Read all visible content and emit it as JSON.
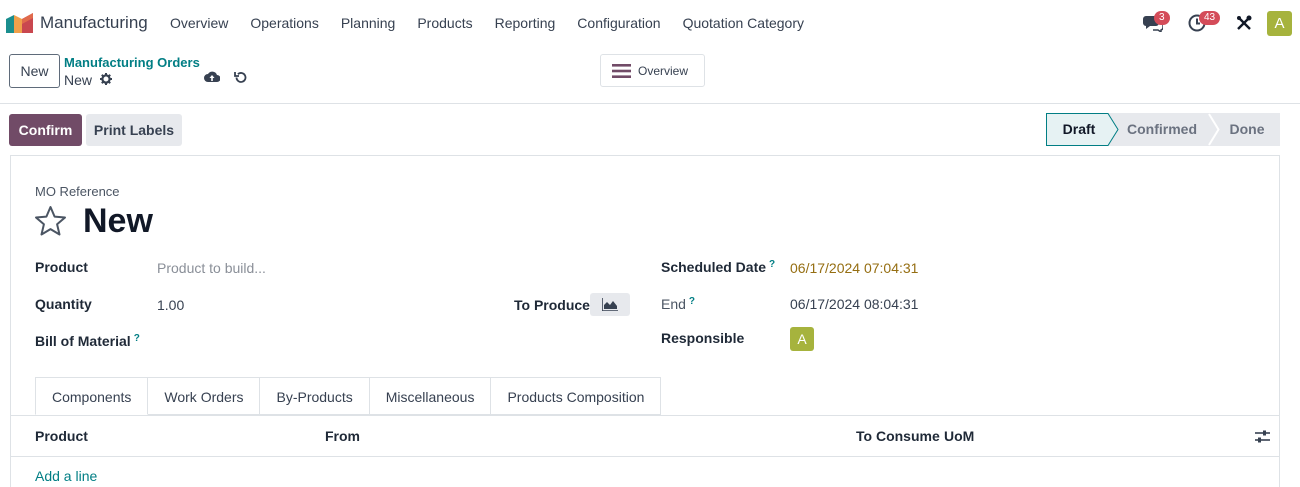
{
  "navbar": {
    "app_name": "Manufacturing",
    "menu": [
      "Overview",
      "Operations",
      "Planning",
      "Products",
      "Reporting",
      "Configuration",
      "Quotation Category"
    ],
    "messages_count": "3",
    "activities_count": "43",
    "user_initial": "A"
  },
  "control_panel": {
    "new_label": "New",
    "breadcrumb_parent": "Manufacturing Orders",
    "breadcrumb_current": "New",
    "overview_label": "Overview"
  },
  "statusbar": {
    "confirm_label": "Confirm",
    "print_labels_label": "Print Labels",
    "stages": [
      "Draft",
      "Confirmed",
      "Done"
    ],
    "active_stage": "Draft"
  },
  "form": {
    "ref_label": "MO Reference",
    "title": "New",
    "product_label": "Product",
    "product_placeholder": "Product to build...",
    "quantity_label": "Quantity",
    "quantity_value": "1.00",
    "to_produce_label": "To Produce",
    "bom_label": "Bill of Material",
    "scheduled_label": "Scheduled Date",
    "scheduled_value": "06/17/2024 07:04:31",
    "end_label": "End",
    "end_value": "06/17/2024 08:04:31",
    "responsible_label": "Responsible",
    "responsible_initial": "A",
    "help_mark": "?"
  },
  "tabs": [
    "Components",
    "Work Orders",
    "By-Products",
    "Miscellaneous",
    "Products Composition"
  ],
  "table": {
    "headers": [
      "Product",
      "From",
      "To Consume",
      "UoM"
    ],
    "add_line": "Add a line"
  },
  "colors": {
    "primary": "#714b67",
    "link": "#017e84",
    "avatar": "#a6b33d",
    "badge": "#d44c59",
    "scheduled": "#956e12"
  }
}
